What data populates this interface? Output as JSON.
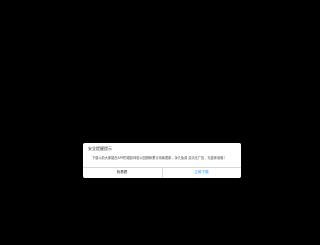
{
  "dialog": {
    "title": "安全提醒提示",
    "message": "下载以前大家能在APP的观影体验以回顾和累计持续更新，永久免费 高清无广告，无缝体验哦！",
    "cancel_label": "我看看",
    "confirm_label": "立即下载"
  },
  "colors": {
    "background": "#000000",
    "dialog_bg": "#ffffff",
    "confirm_text": "#2c8ff0"
  }
}
